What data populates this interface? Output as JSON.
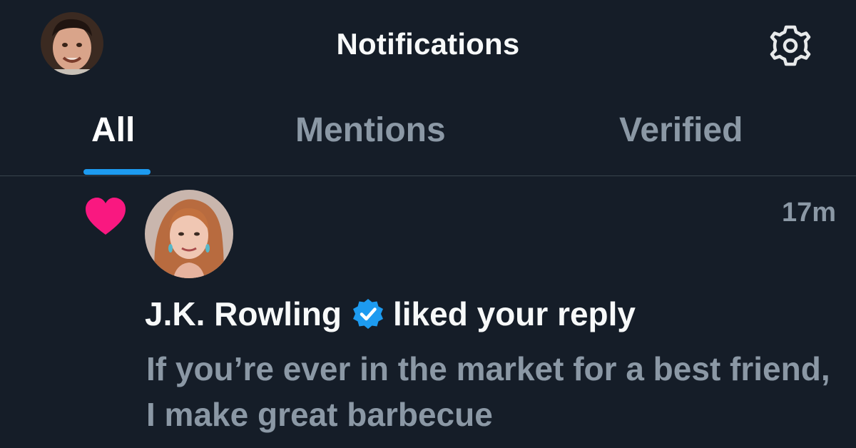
{
  "header": {
    "title": "Notifications",
    "avatar_icon": "user-avatar",
    "settings_icon": "gear-icon"
  },
  "tabs": [
    {
      "label": "All",
      "active": true
    },
    {
      "label": "Mentions",
      "active": false
    },
    {
      "label": "Verified",
      "active": false
    }
  ],
  "notification": {
    "type_icon": "heart-icon",
    "user_name": "J.K. Rowling",
    "verified": true,
    "action_text": "liked your reply",
    "time": "17m",
    "reply_text": "If you’re ever in the market for a best friend, I make great barbecue"
  },
  "colors": {
    "background": "#151d28",
    "accent": "#1d9bf0",
    "like": "#f91880",
    "muted": "#8b98a5"
  }
}
